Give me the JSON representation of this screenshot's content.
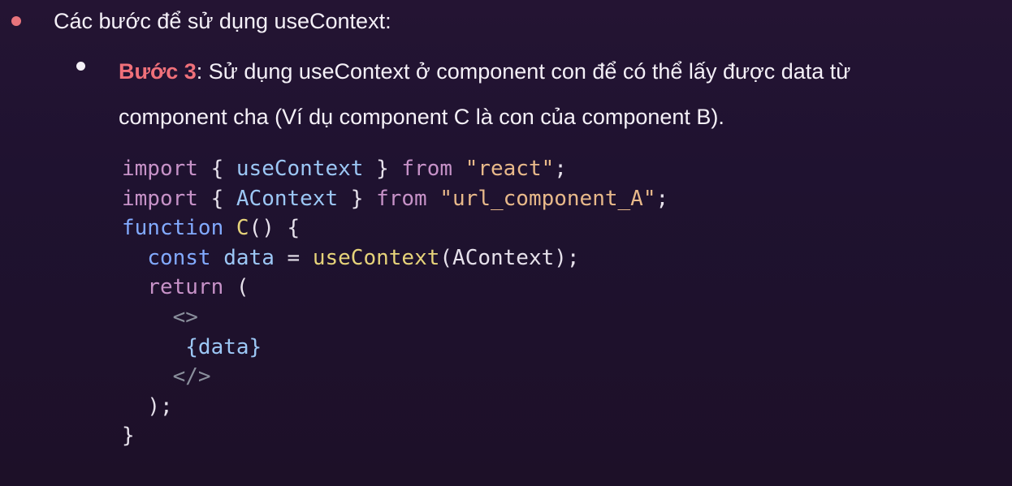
{
  "heading": "Các bước để sử dụng useContext:",
  "step": {
    "label": "Bước 3",
    "text_line1": ": Sử dụng useContext ở component con để có thể lấy được data từ",
    "text_line2": "component cha (Ví dụ component C là con của component B)."
  },
  "code": {
    "l1": {
      "kw": "import",
      "open": " { ",
      "name": "useContext",
      "close": " } ",
      "from": "from",
      "sp": " ",
      "str": "\"react\"",
      "end": ";"
    },
    "l2": {
      "kw": "import",
      "open": " { ",
      "name": "AContext",
      "close": " } ",
      "from": "from",
      "sp": " ",
      "str": "\"url_component_A\"",
      "end": ";"
    },
    "l3": {
      "kw": "function",
      "sp": " ",
      "fn": "C",
      "rest": "() {"
    },
    "l4": {
      "indent": "  ",
      "kw": "const",
      "sp": " ",
      "var": "data",
      "eq": " = ",
      "fn": "useContext",
      "rest": "(AContext);"
    },
    "l5": {
      "indent": "  ",
      "kw": "return",
      "rest": " ("
    },
    "l6": {
      "indent": "    ",
      "tag": "<>"
    },
    "l7": {
      "indent": "     ",
      "expr": "{data}"
    },
    "l8": {
      "indent": "    ",
      "tag": "</>"
    },
    "l9": {
      "indent": "  ",
      "rest": ");"
    },
    "l10": {
      "rest": "}"
    }
  },
  "colors": {
    "step_label": "#f0707a",
    "bullet_main": "#e8747c",
    "background": "#211330"
  }
}
